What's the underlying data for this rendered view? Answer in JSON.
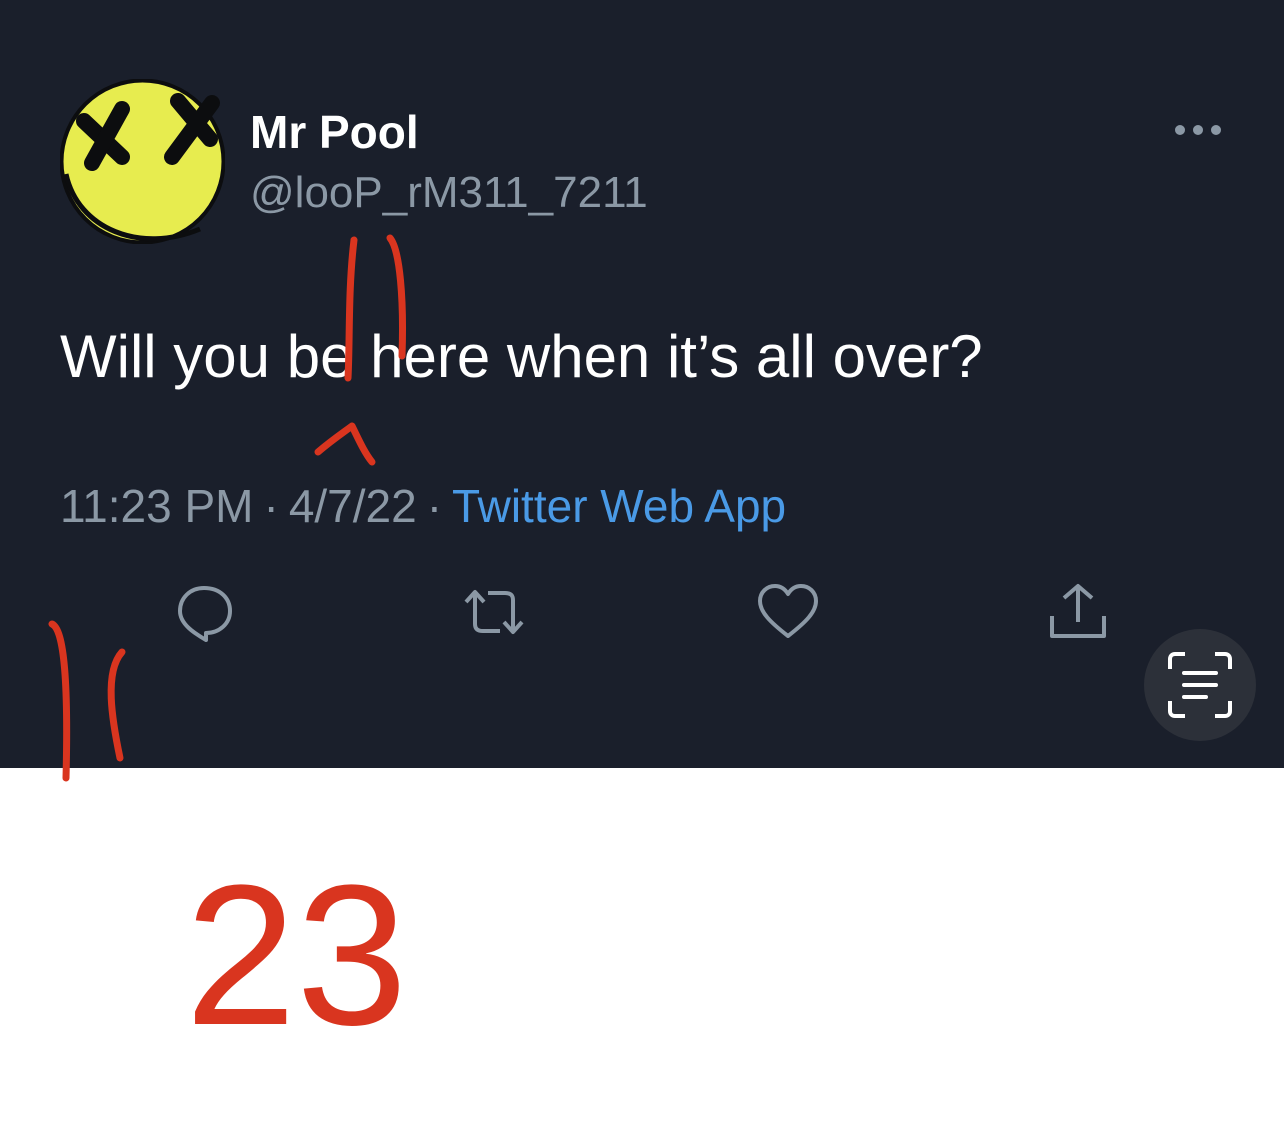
{
  "tweet": {
    "display_name": "Mr Pool",
    "handle": "@looP_rM311_7211",
    "text": "Will you be here when it’s all over?",
    "time": "11:23 PM",
    "separator": "·",
    "date": "4/7/22",
    "source": "Twitter Web App"
  },
  "actions": {
    "reply_icon": "reply-icon",
    "retweet_icon": "retweet-icon",
    "like_icon": "heart-icon",
    "share_icon": "share-icon",
    "more_icon": "more-icon",
    "scan_icon": "live-text-scan-icon"
  },
  "annotations": {
    "number": "23"
  },
  "colors": {
    "background": "#1a1f2b",
    "name": "#ffffff",
    "secondary_text": "#8b98a5",
    "link": "#4a9ae6",
    "avatar": "#e7ec4f",
    "markup_red": "#d9351f"
  }
}
